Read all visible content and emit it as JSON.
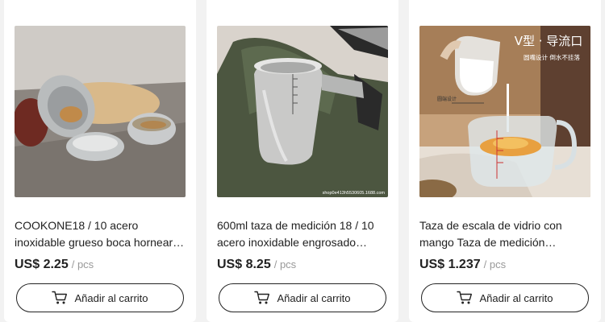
{
  "products": [
    {
      "title": "COOKONE18 / 10 acero inoxidable grueso boca hornear…",
      "price": "US$ 2.25",
      "unit": "/ pcs",
      "button_label": "Añadir al carrito"
    },
    {
      "title": "600ml taza de medición 18 / 10 acero inoxidable engrosado taza…",
      "price": "US$ 8.25",
      "unit": "/ pcs",
      "image_watermark": "shop0e413h5530605.1688.com",
      "button_label": "Añadir al carrito"
    },
    {
      "title": "Taza de escala de vidrio con mango Taza de medición…",
      "price": "US$ 1.237",
      "unit": "/ pcs",
      "image_overlay_title": "V型 · 导流口",
      "image_overlay_sub": "圆嘴设计 倒水不挂落",
      "image_overlay_small": "圆端设计",
      "button_label": "Añadir al carrito"
    }
  ],
  "colors": {
    "page_bg": "#f2f2f2",
    "card_bg": "#ffffff",
    "text": "#222222",
    "muted": "#999999"
  },
  "icons": {
    "cart": "shopping-cart-icon"
  }
}
